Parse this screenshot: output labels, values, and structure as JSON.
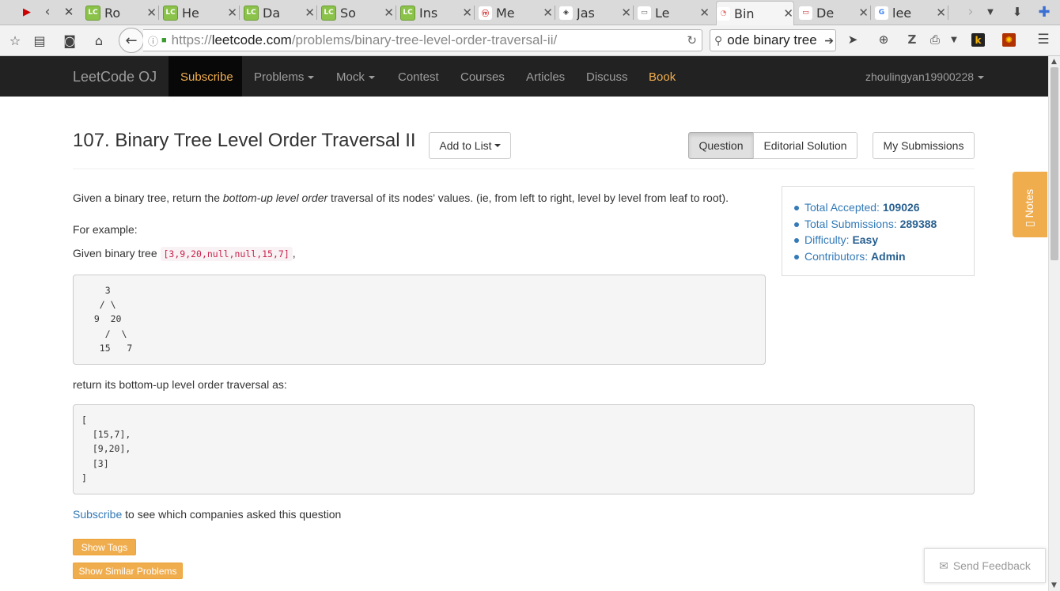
{
  "browser": {
    "tabs": [
      {
        "label": "Ro",
        "favicon": "LC"
      },
      {
        "label": "He",
        "favicon": "LC"
      },
      {
        "label": "Da",
        "favicon": "LC"
      },
      {
        "label": "So",
        "favicon": "LC"
      },
      {
        "label": "Ins",
        "favicon": "LC"
      },
      {
        "label": "Me",
        "favicon": "ⓜ"
      },
      {
        "label": "Jas",
        "favicon": "◈"
      },
      {
        "label": "Le",
        "favicon": "▭"
      },
      {
        "label": "Bin",
        "favicon": "◔"
      },
      {
        "label": "De",
        "favicon": "▭"
      },
      {
        "label": "lee",
        "favicon": "G"
      }
    ],
    "url": {
      "prefix": "https://",
      "host": "leetcode.com",
      "path": "/problems/binary-tree-level-order-traversal-ii/"
    },
    "search_value": "ode binary tree",
    "accent_color": "#f0ad4e"
  },
  "lc_nav": {
    "brand": "LeetCode OJ",
    "subscribe": "Subscribe",
    "problems": "Problems",
    "mock": "Mock",
    "contest": "Contest",
    "courses": "Courses",
    "articles": "Articles",
    "discuss": "Discuss",
    "book": "Book",
    "user": "zhoulingyan19900228"
  },
  "problem": {
    "title": "107. Binary Tree Level Order Traversal II",
    "add_to_list": "Add to List",
    "tab_question": "Question",
    "tab_editorial": "Editorial Solution",
    "my_submissions": "My Submissions",
    "desc_pre": "Given a binary tree, return the ",
    "desc_em": "bottom-up level order",
    "desc_post": " traversal of its nodes' values. (ie, from left to right, level by level from leaf to root).",
    "for_example": "For example:",
    "given_pre": "Given binary tree ",
    "given_code": "[3,9,20,null,null,15,7]",
    "given_post": ",",
    "tree_lines": [
      "    3",
      "   / \\",
      "  9  20",
      "    /  \\",
      "   15   7"
    ],
    "return_text": "return its bottom-up level order traversal as:",
    "result_lines": [
      "[",
      "  [15,7],",
      "  [9,20],",
      "  [3]",
      "]"
    ],
    "subscribe_link": "Subscribe",
    "subscribe_text": " to see which companies asked this question",
    "show_tags": "Show Tags",
    "show_similar": "Show Similar Problems"
  },
  "stats": {
    "accepted_label": "Total Accepted: ",
    "accepted_value": "109026",
    "submissions_label": "Total Submissions: ",
    "submissions_value": "289388",
    "difficulty_label": "Difficulty: ",
    "difficulty_value": "Easy",
    "contributors_label": "Contributors: ",
    "contributors_value": "Admin"
  },
  "notes_label": "Notes",
  "feedback_label": "Send Feedback"
}
